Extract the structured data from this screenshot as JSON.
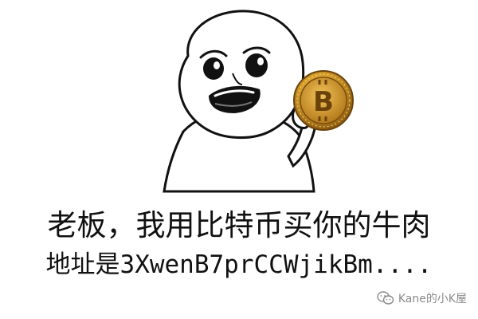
{
  "caption": {
    "line1": "老板，我用比特币买你的牛肉",
    "line2": "地址是3XwenB7prCCWjikBm...."
  },
  "coin": {
    "symbol": "B",
    "icon": "bitcoin-coin-icon"
  },
  "watermark": {
    "icon": "wechat-icon",
    "text": "Kane的小K屋"
  },
  "colors": {
    "background": "#ffffff",
    "text": "#111111",
    "coin_gold": "#d9a12c",
    "coin_dark": "#8a5a10",
    "watermark": "#8a8a8a"
  }
}
